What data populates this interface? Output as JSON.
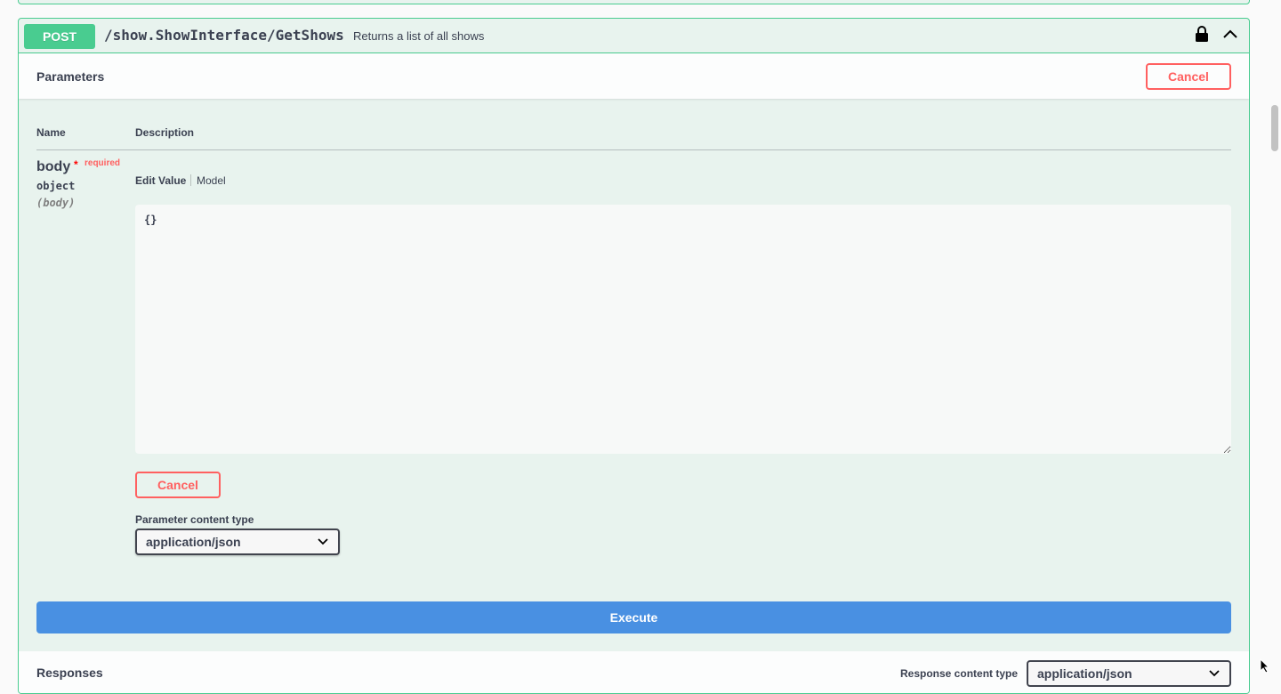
{
  "operation": {
    "method": "POST",
    "path": "/show.ShowInterface/GetShows",
    "summary": "Returns a list of all shows",
    "icons": {
      "lock": "lock-icon",
      "collapse": "chevron-up-icon"
    }
  },
  "parameters": {
    "title": "Parameters",
    "cancel_label": "Cancel",
    "columns": {
      "name": "Name",
      "description": "Description"
    },
    "body": {
      "name": "body",
      "required_star": "*",
      "required_label": "required",
      "type": "object",
      "in": "(body)",
      "tabs": {
        "edit": "Edit Value",
        "model": "Model"
      },
      "value": "{}",
      "cancel_label": "Cancel"
    },
    "content_type": {
      "label": "Parameter content type",
      "selected": "application/json"
    }
  },
  "execute_label": "Execute",
  "responses": {
    "title": "Responses",
    "content_type_label": "Response content type",
    "content_type_selected": "application/json"
  },
  "colors": {
    "post": "#49cc90",
    "post_bg": "#e8f3ee",
    "cancel": "#ff6060",
    "execute": "#4990e2"
  }
}
